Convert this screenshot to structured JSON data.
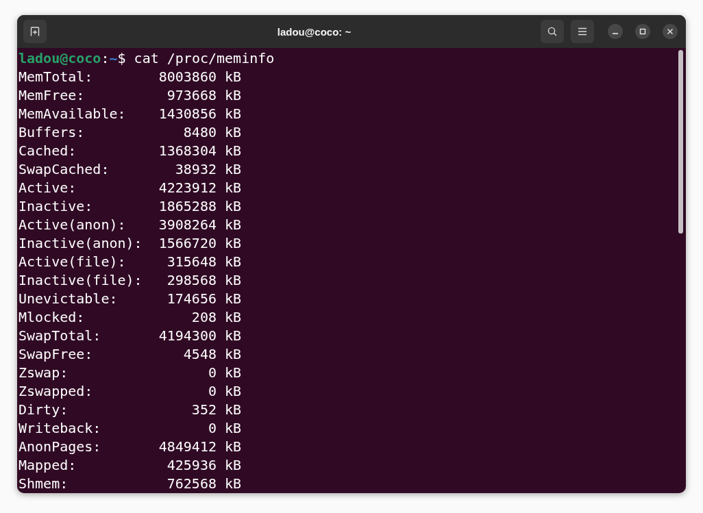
{
  "window": {
    "title": "ladou@coco: ~"
  },
  "prompt": {
    "user_host": "ladou@coco",
    "separator": ":",
    "path": "~",
    "symbol": "$",
    "command": "cat /proc/meminfo"
  },
  "output_lines": [
    "MemTotal:        8003860 kB",
    "MemFree:          973668 kB",
    "MemAvailable:    1430856 kB",
    "Buffers:            8480 kB",
    "Cached:          1368304 kB",
    "SwapCached:        38932 kB",
    "Active:          4223912 kB",
    "Inactive:        1865288 kB",
    "Active(anon):    3908264 kB",
    "Inactive(anon):  1566720 kB",
    "Active(file):     315648 kB",
    "Inactive(file):   298568 kB",
    "Unevictable:      174656 kB",
    "Mlocked:             208 kB",
    "SwapTotal:       4194300 kB",
    "SwapFree:           4548 kB",
    "Zswap:                 0 kB",
    "Zswapped:              0 kB",
    "Dirty:               352 kB",
    "Writeback:             0 kB",
    "AnonPages:       4849412 kB",
    "Mapped:           425936 kB",
    "Shmem:            762568 kB"
  ]
}
